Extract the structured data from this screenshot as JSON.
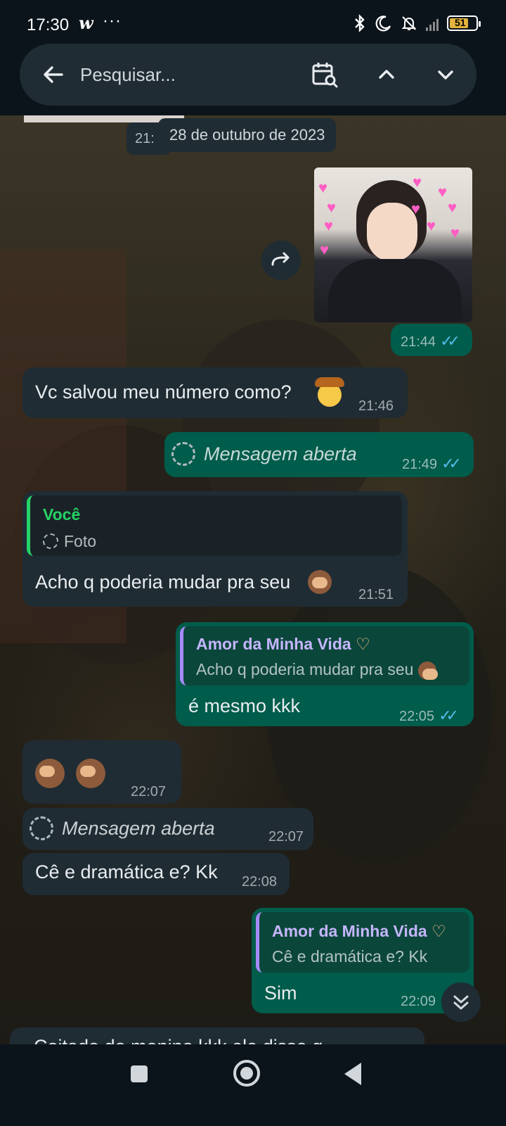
{
  "status_bar": {
    "time": "17:30",
    "app_glyph": "w",
    "more": "···",
    "battery": "51",
    "icons": [
      "bluetooth-icon",
      "moon-icon",
      "bell-off-icon",
      "signal-icon",
      "battery-icon"
    ]
  },
  "search": {
    "placeholder": "Pesquisar..."
  },
  "chat": {
    "date_separator": "28 de outubro de 2023",
    "prev_time": "21:",
    "messages": [
      {
        "id": "m1",
        "dir": "out",
        "type": "image",
        "time": "21:44"
      },
      {
        "id": "m2",
        "dir": "in",
        "text": "Vc salvou meu número como?",
        "time": "21:46"
      },
      {
        "id": "m3",
        "dir": "out",
        "text": "Mensagem aberta",
        "time": "21:49"
      },
      {
        "id": "m4",
        "dir": "in",
        "quote_author": "Você",
        "quote_text": "Foto",
        "text": "Acho q poderia mudar pra seu",
        "time": "21:51"
      },
      {
        "id": "m5",
        "dir": "out",
        "quote_author": "Amor da Minha Vida",
        "quote_text": "Acho q poderia mudar pra seu",
        "text": "é mesmo kkk",
        "time": "22:05"
      },
      {
        "id": "m6",
        "dir": "in",
        "text": "",
        "time": "22:07"
      },
      {
        "id": "m7",
        "dir": "in",
        "text": "Mensagem aberta",
        "time": "22:07"
      },
      {
        "id": "m8",
        "dir": "in",
        "text": "Cê e dramática e? Kk",
        "time": "22:08"
      },
      {
        "id": "m9",
        "dir": "out",
        "quote_author": "Amor da Minha Vida",
        "quote_text": "Cê e dramática e? Kk",
        "text": "Sim",
        "time": "22:09"
      }
    ],
    "cut_text": "Coitado do menino kkk ele disse q"
  },
  "colors": {
    "incoming": "#1f2c34",
    "outgoing": "#005c4b",
    "read_ticks": "#53bdeb",
    "quote_green": "#25d366",
    "quote_purple": "#a78bfa"
  }
}
